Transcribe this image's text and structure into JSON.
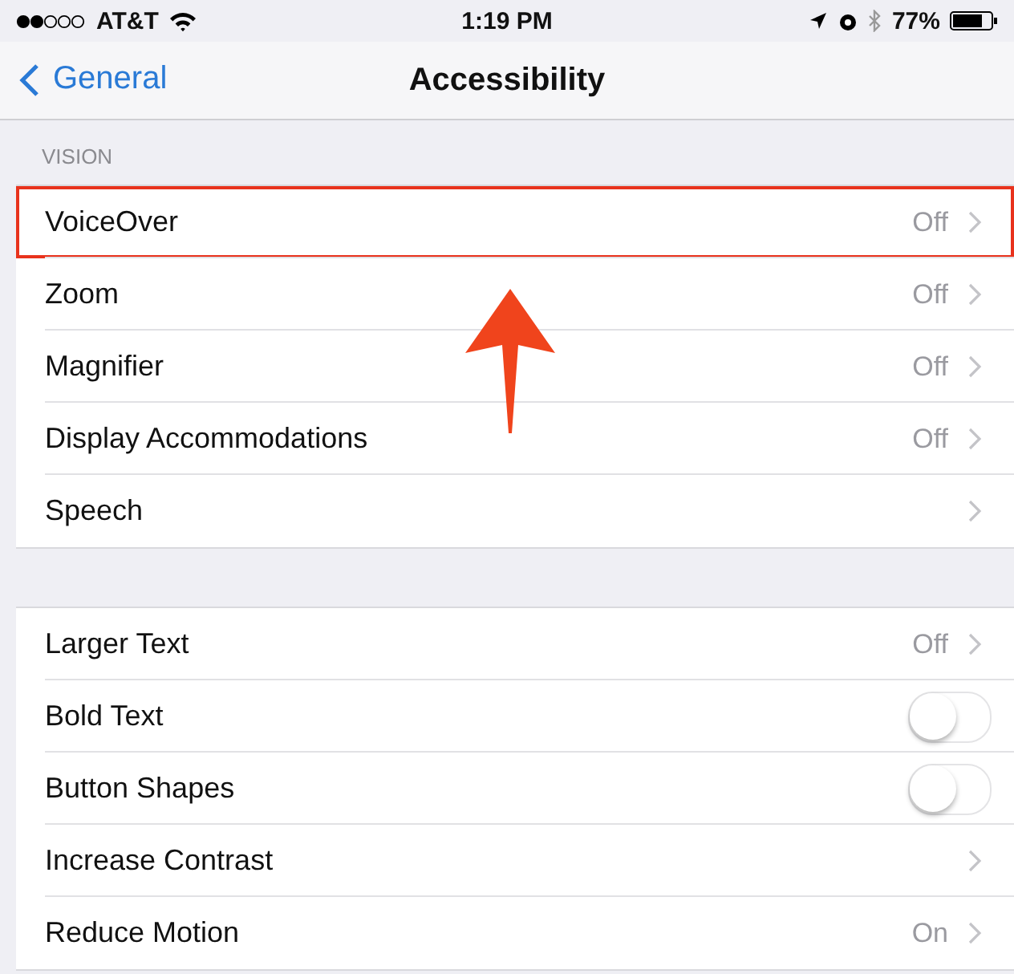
{
  "status_bar": {
    "carrier": "AT&T",
    "time": "1:19 PM",
    "battery": "77%"
  },
  "nav": {
    "back": "General",
    "title": "Accessibility"
  },
  "sections": [
    {
      "header": "VISION",
      "rows": [
        {
          "kind": "link",
          "label": "VoiceOver",
          "value": "Off",
          "highlighted": true
        },
        {
          "kind": "link",
          "label": "Zoom",
          "value": "Off",
          "highlighted": false
        },
        {
          "kind": "link",
          "label": "Magnifier",
          "value": "Off",
          "highlighted": false
        },
        {
          "kind": "link",
          "label": "Display Accommodations",
          "value": "Off",
          "highlighted": false
        },
        {
          "kind": "link",
          "label": "Speech",
          "highlighted": false
        }
      ]
    },
    {
      "rows": [
        {
          "kind": "link",
          "label": "Larger Text",
          "value": "Off",
          "highlighted": false
        },
        {
          "kind": "toggle",
          "label": "Bold Text",
          "on": false,
          "highlighted": false
        },
        {
          "kind": "toggle",
          "label": "Button Shapes",
          "on": false,
          "highlighted": false
        },
        {
          "kind": "link",
          "label": "Increase Contrast",
          "highlighted": false
        },
        {
          "kind": "link",
          "label": "Reduce Motion",
          "value": "On",
          "highlighted": false
        }
      ]
    }
  ]
}
